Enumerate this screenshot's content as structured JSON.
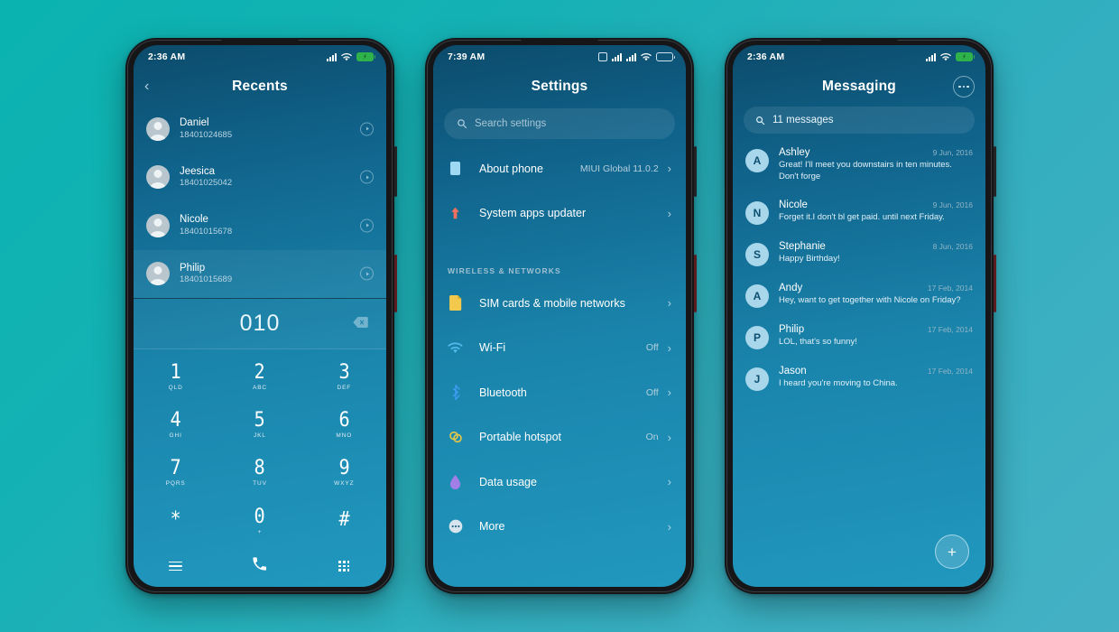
{
  "background": {
    "from": "#0ab3b0",
    "to": "#45b0c4"
  },
  "phones": {
    "dialer": {
      "status": {
        "time": "2:36 AM",
        "battery_state": "charging"
      },
      "header": {
        "title": "Recents",
        "back_icon": "chevron-left-icon"
      },
      "recents": [
        {
          "name": "Daniel",
          "number": "18401024685",
          "selected": false
        },
        {
          "name": "Jeesica",
          "number": "18401025042",
          "selected": false
        },
        {
          "name": "Nicole",
          "number": "18401015678",
          "selected": false
        },
        {
          "name": "Philip",
          "number": "18401015689",
          "selected": true
        }
      ],
      "dialed_number": "010",
      "keys": [
        {
          "digit": "1",
          "letters": "QLD"
        },
        {
          "digit": "2",
          "letters": "ABC"
        },
        {
          "digit": "3",
          "letters": "DEF"
        },
        {
          "digit": "4",
          "letters": "GHI"
        },
        {
          "digit": "5",
          "letters": "JKL"
        },
        {
          "digit": "6",
          "letters": "MNO"
        },
        {
          "digit": "7",
          "letters": "PQRS"
        },
        {
          "digit": "8",
          "letters": "TUV"
        },
        {
          "digit": "9",
          "letters": "WXYZ"
        },
        {
          "digit": "*",
          "letters": ""
        },
        {
          "digit": "0",
          "letters": "+"
        },
        {
          "digit": "#",
          "letters": ""
        }
      ],
      "bottom_bar": [
        "menu-icon",
        "call-icon",
        "keypad-icon"
      ]
    },
    "settings": {
      "status": {
        "time": "7:39 AM",
        "battery_state": "normal"
      },
      "header": {
        "title": "Settings"
      },
      "search": {
        "placeholder": "Search settings",
        "icon": "search-icon"
      },
      "items": [
        {
          "label": "About phone",
          "value": "MIUI Global 11.0.2",
          "icon": "phone-info-icon",
          "color": "#9fd8f2"
        },
        {
          "label": "System apps updater",
          "value": "",
          "icon": "up-arrow-icon",
          "color": "#f2705e"
        }
      ],
      "section_title": "WIRELESS & NETWORKS",
      "network_items": [
        {
          "label": "SIM cards & mobile networks",
          "value": "",
          "icon": "sim-card-icon",
          "color": "#f2c94c"
        },
        {
          "label": "Wi-Fi",
          "value": "Off",
          "icon": "wifi-icon",
          "color": "#4fb8e8"
        },
        {
          "label": "Bluetooth",
          "value": "Off",
          "icon": "bluetooth-icon",
          "color": "#3d9bf0"
        },
        {
          "label": "Portable hotspot",
          "value": "On",
          "icon": "hotspot-icon",
          "color": "#e6c84a"
        },
        {
          "label": "Data usage",
          "value": "",
          "icon": "data-drop-icon",
          "color": "#a27ee8"
        },
        {
          "label": "More",
          "value": "",
          "icon": "more-icon",
          "color": "#d8e4ee"
        }
      ]
    },
    "messaging": {
      "status": {
        "time": "2:36 AM",
        "battery_state": "charging"
      },
      "header": {
        "title": "Messaging",
        "menu_icon": "overflow-menu-icon"
      },
      "search": {
        "text": "11 messages",
        "icon": "search-icon"
      },
      "threads": [
        {
          "initial": "A",
          "name": "Ashley",
          "date": "9 Jun, 2016",
          "preview": "Great! I'll meet you downstairs in ten minutes. Don't forge"
        },
        {
          "initial": "N",
          "name": "Nicole",
          "date": "9 Jun, 2016",
          "preview": "Forget it.I don't bl get paid. until next Friday."
        },
        {
          "initial": "S",
          "name": "Stephanie",
          "date": "8 Jun, 2016",
          "preview": "Happy Birthday!"
        },
        {
          "initial": "A",
          "name": "Andy",
          "date": "17 Feb, 2014",
          "preview": "Hey, want to get together with Nicole on Friday?"
        },
        {
          "initial": "P",
          "name": "Philip",
          "date": "17 Feb, 2014",
          "preview": "LOL, that's so funny!"
        },
        {
          "initial": "J",
          "name": "Jason",
          "date": "17 Feb, 2014",
          "preview": "I heard you're moving to China."
        }
      ],
      "fab": {
        "label": "+",
        "icon": "plus-icon"
      }
    }
  }
}
